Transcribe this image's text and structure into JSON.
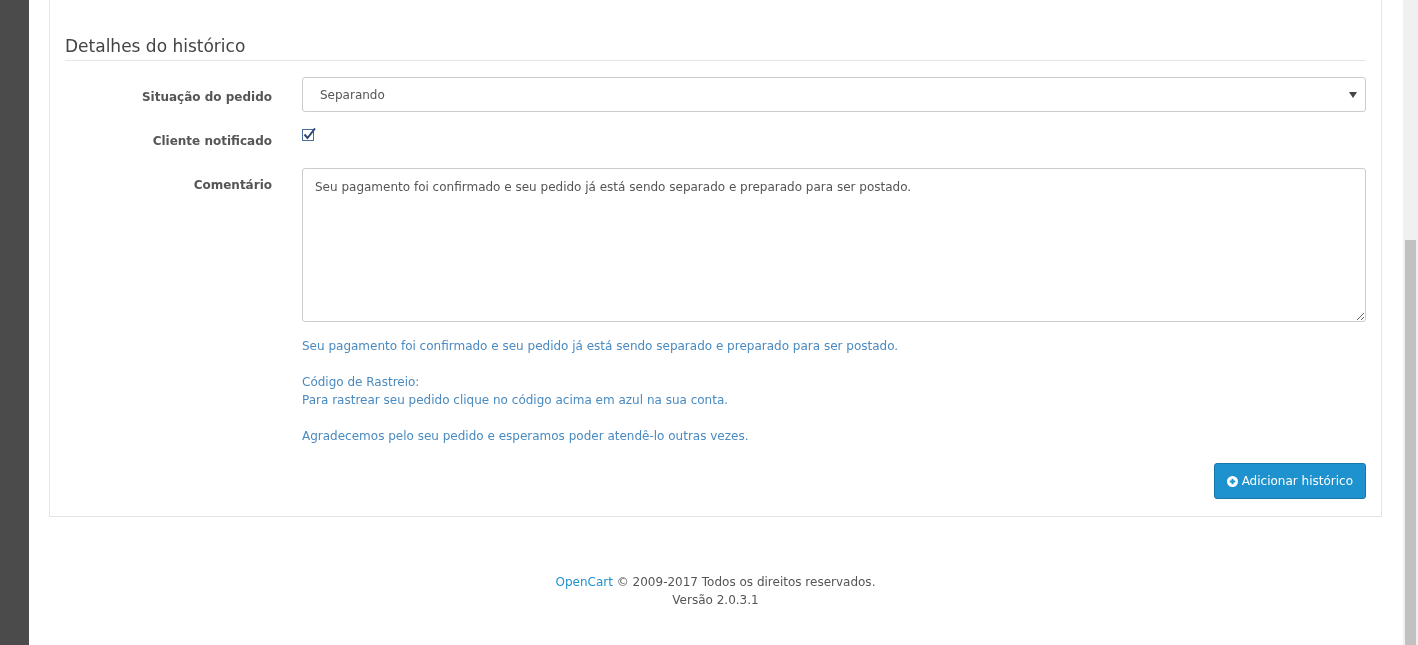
{
  "section_title": "Detalhes do histórico",
  "fields": [
    {
      "kind": "select",
      "label": "Situação do pedido",
      "value": "Separando"
    },
    {
      "kind": "checkbox",
      "label": "Cliente notificado",
      "checked": true
    },
    {
      "kind": "textarea",
      "label": "Comentário",
      "value": "Seu pagamento foi confirmado e seu pedido já está sendo separado e preparado para ser postado."
    }
  ],
  "help_paragraphs": [
    [
      "Seu pagamento foi confirmado e seu pedido já está sendo separado e preparado para ser postado."
    ],
    [
      "Código de Rastreio:",
      "Para rastrear seu pedido clique no código acima em azul na sua conta."
    ],
    [
      "Agradecemos pelo seu pedido e esperamos poder atendê-lo outras vezes."
    ]
  ],
  "submit_button": "Adicionar histórico",
  "footer": {
    "link": "OpenCart",
    "text": "© 2009-2017 Todos os direitos reservados.",
    "version": "Versão 2.0.3.1"
  }
}
